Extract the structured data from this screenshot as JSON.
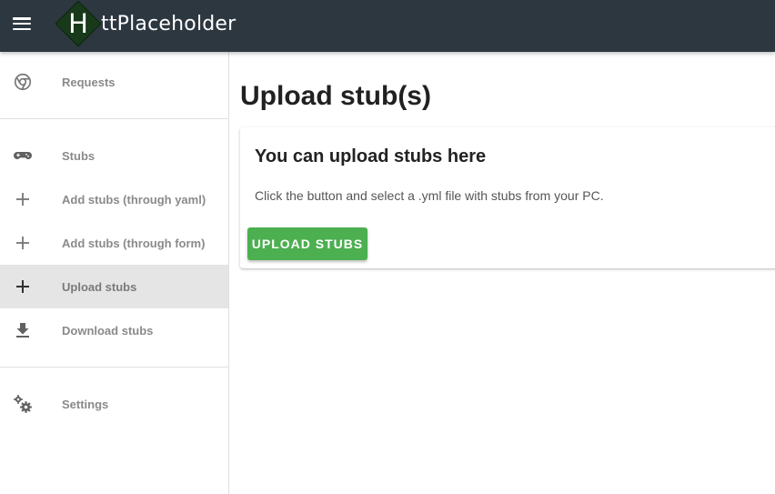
{
  "app": {
    "logo_letter": "H",
    "logo_text": "ttPlaceholder"
  },
  "header": {
    "menu_icon": "hamburger-menu-icon"
  },
  "sidebar": {
    "items": [
      {
        "label": "Requests",
        "icon": "chrome-browser-icon"
      },
      {
        "label": "Stubs",
        "icon": "gamepad-icon"
      },
      {
        "label": "Add stubs (through yaml)",
        "icon": "plus-icon"
      },
      {
        "label": "Add stubs (through form)",
        "icon": "plus-icon"
      },
      {
        "label": "Upload stubs",
        "icon": "plus-icon",
        "active": true
      },
      {
        "label": "Download stubs",
        "icon": "download-icon"
      },
      {
        "label": "Settings",
        "icon": "gears-icon"
      }
    ]
  },
  "main": {
    "title": "Upload stub(s)",
    "card": {
      "title": "You can upload stubs here",
      "text": "Click the button and select a .yml file with stubs from your PC.",
      "button_label": "UPLOAD STUBS"
    }
  },
  "colors": {
    "topbar": "#2c3740",
    "accent_green": "#4caf50",
    "logo_diamond": "#18391a",
    "active_item_bg": "#e5e5e5"
  }
}
